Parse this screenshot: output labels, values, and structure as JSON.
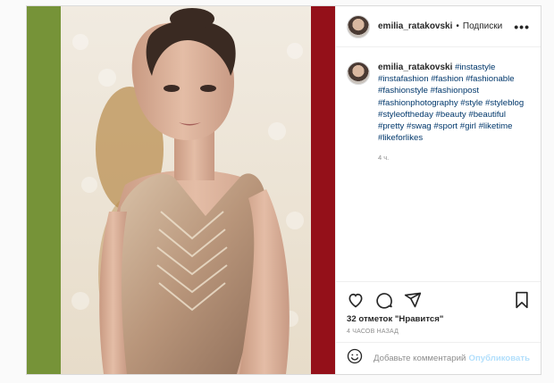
{
  "header": {
    "username": "emilia_ratakovski",
    "separator": "•",
    "follow_label": "Подписки",
    "more_icon": "more-horizontal-icon"
  },
  "caption": {
    "username": "emilia_ratakovski",
    "hashtags": [
      "#instastyle",
      "#instafashion",
      "#fashion",
      "#fashionable",
      "#fashionstyle",
      "#fashionpost",
      "#fashionphotography",
      "#style",
      "#styleblog",
      "#styleoftheday",
      "#beauty",
      "#beautiful",
      "#pretty",
      "#swag",
      "#sport",
      "#girl",
      "#liketime",
      "#likeforlikes"
    ],
    "time": "4 ч."
  },
  "actions": {
    "like_icon": "heart-icon",
    "comment_icon": "comment-icon",
    "share_icon": "share-icon",
    "save_icon": "bookmark-icon",
    "likes_text": "32 отметок \"Нравится\"",
    "ago_text": "4 часов назад"
  },
  "comment_box": {
    "emoji_icon": "emoji-icon",
    "placeholder": "Добавьте комментарий...",
    "publish_label": "Опубликовать"
  },
  "colors": {
    "link": "#00376b",
    "publish_disabled": "#b2dffc",
    "border": "#dbdbdb"
  }
}
